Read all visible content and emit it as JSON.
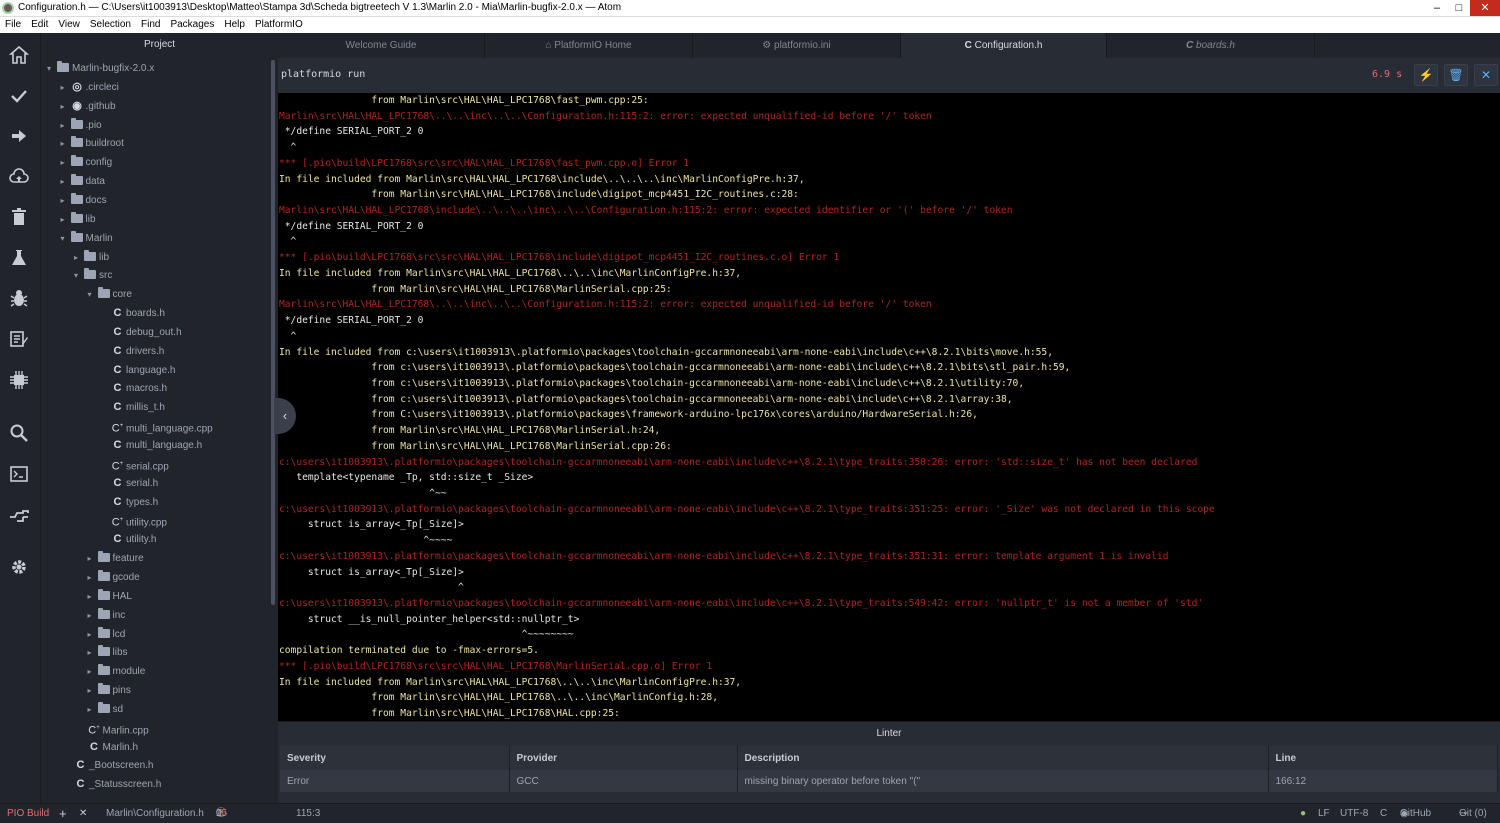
{
  "window": {
    "title": "Configuration.h — C:\\Users\\it1003913\\Desktop\\Matteo\\Stampa 3d\\Scheda bigtreetech V 1.3\\Marlin 2.0 - Mia\\Marlin-bugfix-2.0.x — Atom",
    "minimize": "–",
    "maximize": "□",
    "close": "✕"
  },
  "menu": [
    "File",
    "Edit",
    "View",
    "Selection",
    "Find",
    "Packages",
    "Help",
    "PlatformIO"
  ],
  "activity": [
    "home-icon",
    "check-icon",
    "arrow-right-icon",
    "cloud-upload-icon",
    "trash-icon",
    "flask-icon",
    "bug-icon",
    "edit-list-icon",
    "chip-icon",
    "search-icon",
    "terminal-icon",
    "plug-icon",
    "gear-icon"
  ],
  "tree": {
    "header": "Project",
    "items": [
      {
        "label": "Marlin-bugfix-2.0.x",
        "depth": 0,
        "kind": "folder",
        "open": true
      },
      {
        "label": ".circleci",
        "depth": 1,
        "kind": "circle",
        "open": false
      },
      {
        "label": ".github",
        "depth": 1,
        "kind": "github",
        "open": false
      },
      {
        "label": ".pio",
        "depth": 1,
        "kind": "folder",
        "open": false
      },
      {
        "label": "buildroot",
        "depth": 1,
        "kind": "folder",
        "open": false
      },
      {
        "label": "config",
        "depth": 1,
        "kind": "folder",
        "open": false
      },
      {
        "label": "data",
        "depth": 1,
        "kind": "folder",
        "open": false
      },
      {
        "label": "docs",
        "depth": 1,
        "kind": "folder",
        "open": false
      },
      {
        "label": "lib",
        "depth": 1,
        "kind": "folder",
        "open": false
      },
      {
        "label": "Marlin",
        "depth": 1,
        "kind": "folder",
        "open": true
      },
      {
        "label": "lib",
        "depth": 2,
        "kind": "folder",
        "open": false
      },
      {
        "label": "src",
        "depth": 2,
        "kind": "folder",
        "open": true
      },
      {
        "label": "core",
        "depth": 3,
        "kind": "folder",
        "open": true
      },
      {
        "label": "boards.h",
        "depth": 4,
        "kind": "c"
      },
      {
        "label": "debug_out.h",
        "depth": 4,
        "kind": "c"
      },
      {
        "label": "drivers.h",
        "depth": 4,
        "kind": "c"
      },
      {
        "label": "language.h",
        "depth": 4,
        "kind": "c"
      },
      {
        "label": "macros.h",
        "depth": 4,
        "kind": "c"
      },
      {
        "label": "millis_t.h",
        "depth": 4,
        "kind": "c"
      },
      {
        "label": "multi_language.cpp",
        "depth": 4,
        "kind": "cpp"
      },
      {
        "label": "multi_language.h",
        "depth": 4,
        "kind": "c"
      },
      {
        "label": "serial.cpp",
        "depth": 4,
        "kind": "cpp"
      },
      {
        "label": "serial.h",
        "depth": 4,
        "kind": "c"
      },
      {
        "label": "types.h",
        "depth": 4,
        "kind": "c"
      },
      {
        "label": "utility.cpp",
        "depth": 4,
        "kind": "cpp"
      },
      {
        "label": "utility.h",
        "depth": 4,
        "kind": "c"
      },
      {
        "label": "feature",
        "depth": 3,
        "kind": "folder",
        "open": false
      },
      {
        "label": "gcode",
        "depth": 3,
        "kind": "folder",
        "open": false
      },
      {
        "label": "HAL",
        "depth": 3,
        "kind": "folder",
        "open": false
      },
      {
        "label": "inc",
        "depth": 3,
        "kind": "folder",
        "open": false
      },
      {
        "label": "lcd",
        "depth": 3,
        "kind": "folder",
        "open": false
      },
      {
        "label": "libs",
        "depth": 3,
        "kind": "folder",
        "open": false
      },
      {
        "label": "module",
        "depth": 3,
        "kind": "folder",
        "open": false
      },
      {
        "label": "pins",
        "depth": 3,
        "kind": "folder",
        "open": false
      },
      {
        "label": "sd",
        "depth": 3,
        "kind": "folder",
        "open": false
      },
      {
        "label": "Marlin.cpp",
        "depth": 3,
        "kind": "cpp",
        "nochev": true
      },
      {
        "label": "Marlin.h",
        "depth": 3,
        "kind": "c",
        "nochev": true
      },
      {
        "label": "_Bootscreen.h",
        "depth": 2,
        "kind": "c",
        "nochev": true
      },
      {
        "label": "_Statusscreen.h",
        "depth": 2,
        "kind": "c",
        "nochev": true
      }
    ]
  },
  "tabs": [
    {
      "label": "Welcome Guide",
      "icon": ""
    },
    {
      "label": "PlatformIO Home",
      "icon": "⌂"
    },
    {
      "label": "platformio.ini",
      "icon": "⚙"
    },
    {
      "label": "Configuration.h",
      "icon": "C",
      "active": true
    },
    {
      "label": "boards.h",
      "icon": "C",
      "italic": true
    }
  ],
  "build": {
    "command": "platformio run",
    "time": "6.9 s",
    "lines": [
      {
        "t": "                from Marlin\\src\\HAL\\HAL_LPC1768\\fast_pwm.cpp:25:",
        "c": "yellow"
      },
      {
        "t": "Marlin\\src\\HAL\\HAL_LPC1768\\..\\..\\inc\\..\\..\\Configuration.h:115:2: error: expected unqualified-id before '/' token",
        "c": "red"
      },
      {
        "t": " */define SERIAL_PORT_2 0",
        "c": "white"
      },
      {
        "t": "  ^",
        "c": "white"
      },
      {
        "t": "*** [.pio\\build\\LPC1768\\src\\src\\HAL\\HAL_LPC1768\\fast_pwm.cpp.o] Error 1",
        "c": "red"
      },
      {
        "t": "In file included from Marlin\\src\\HAL\\HAL_LPC1768\\include\\..\\..\\..\\inc\\MarlinConfigPre.h:37,",
        "c": "yellow"
      },
      {
        "t": "                from Marlin\\src\\HAL\\HAL_LPC1768\\include\\digipot_mcp4451_I2C_routines.c:28:",
        "c": "yellow"
      },
      {
        "t": "Marlin\\src\\HAL\\HAL_LPC1768\\include\\..\\..\\..\\inc\\..\\..\\Configuration.h:115:2: error: expected identifier or '(' before '/' token",
        "c": "red"
      },
      {
        "t": " */define SERIAL_PORT_2 0",
        "c": "white"
      },
      {
        "t": "  ^",
        "c": "white"
      },
      {
        "t": "*** [.pio\\build\\LPC1768\\src\\src\\HAL\\HAL_LPC1768\\include\\digipot_mcp4451_I2C_routines.c.o] Error 1",
        "c": "red"
      },
      {
        "t": "In file included from Marlin\\src\\HAL\\HAL_LPC1768\\..\\..\\inc\\MarlinConfigPre.h:37,",
        "c": "yellow"
      },
      {
        "t": "                from Marlin\\src\\HAL\\HAL_LPC1768\\MarlinSerial.cpp:25:",
        "c": "yellow"
      },
      {
        "t": "Marlin\\src\\HAL\\HAL_LPC1768\\..\\..\\inc\\..\\..\\Configuration.h:115:2: error: expected unqualified-id before '/' token",
        "c": "red"
      },
      {
        "t": " */define SERIAL_PORT_2 0",
        "c": "white"
      },
      {
        "t": "  ^",
        "c": "white"
      },
      {
        "t": "In file included from c:\\users\\it1003913\\.platformio\\packages\\toolchain-gccarmnoneeabi\\arm-none-eabi\\include\\c++\\8.2.1\\bits\\move.h:55,",
        "c": "yellow"
      },
      {
        "t": "                from c:\\users\\it1003913\\.platformio\\packages\\toolchain-gccarmnoneeabi\\arm-none-eabi\\include\\c++\\8.2.1\\bits\\stl_pair.h:59,",
        "c": "yellow"
      },
      {
        "t": "                from c:\\users\\it1003913\\.platformio\\packages\\toolchain-gccarmnoneeabi\\arm-none-eabi\\include\\c++\\8.2.1\\utility:70,",
        "c": "yellow"
      },
      {
        "t": "                from c:\\users\\it1003913\\.platformio\\packages\\toolchain-gccarmnoneeabi\\arm-none-eabi\\include\\c++\\8.2.1\\array:38,",
        "c": "yellow"
      },
      {
        "t": "                from C:\\users\\it1003913\\.platformio\\packages\\framework-arduino-lpc176x\\cores\\arduino/HardwareSerial.h:26,",
        "c": "yellow"
      },
      {
        "t": "                from Marlin\\src\\HAL\\HAL_LPC1768\\MarlinSerial.h:24,",
        "c": "yellow"
      },
      {
        "t": "                from Marlin\\src\\HAL\\HAL_LPC1768\\MarlinSerial.cpp:26:",
        "c": "yellow"
      },
      {
        "t": "c:\\users\\it1003913\\.platformio\\packages\\toolchain-gccarmnoneeabi\\arm-none-eabi\\include\\c++\\8.2.1\\type_traits:350:26: error: 'std::size_t' has not been declared",
        "c": "red"
      },
      {
        "t": "   template<typename _Tp, std::size_t _Size>",
        "c": "white"
      },
      {
        "t": "                          ^~~",
        "c": "white"
      },
      {
        "t": "c:\\users\\it1003913\\.platformio\\packages\\toolchain-gccarmnoneeabi\\arm-none-eabi\\include\\c++\\8.2.1\\type_traits:351:25: error: '_Size' was not declared in this scope",
        "c": "red"
      },
      {
        "t": "     struct is_array<_Tp[_Size]>",
        "c": "white"
      },
      {
        "t": "                         ^~~~~",
        "c": "white"
      },
      {
        "t": "c:\\users\\it1003913\\.platformio\\packages\\toolchain-gccarmnoneeabi\\arm-none-eabi\\include\\c++\\8.2.1\\type_traits:351:31: error: template argument 1 is invalid",
        "c": "red"
      },
      {
        "t": "     struct is_array<_Tp[_Size]>",
        "c": "white"
      },
      {
        "t": "                               ^",
        "c": "white"
      },
      {
        "t": "c:\\users\\it1003913\\.platformio\\packages\\toolchain-gccarmnoneeabi\\arm-none-eabi\\include\\c++\\8.2.1\\type_traits:549:42: error: 'nullptr_t' is not a member of 'std'",
        "c": "red"
      },
      {
        "t": "     struct __is_null_pointer_helper<std::nullptr_t>",
        "c": "white"
      },
      {
        "t": "                                          ^~~~~~~~~",
        "c": "white"
      },
      {
        "t": "compilation terminated due to -fmax-errors=5.",
        "c": "yellow"
      },
      {
        "t": "*** [.pio\\build\\LPC1768\\src\\src\\HAL\\HAL_LPC1768\\MarlinSerial.cpp.o] Error 1",
        "c": "red"
      },
      {
        "t": "In file included from Marlin\\src\\HAL\\HAL_LPC1768\\..\\..\\inc\\MarlinConfigPre.h:37,",
        "c": "yellow"
      },
      {
        "t": "                from Marlin\\src\\HAL\\HAL_LPC1768\\..\\..\\inc\\MarlinConfig.h:28,",
        "c": "yellow"
      },
      {
        "t": "                from Marlin\\src\\HAL\\HAL_LPC1768\\HAL.cpp:25:",
        "c": "yellow"
      }
    ]
  },
  "linter": {
    "title": "Linter",
    "columns": [
      "Severity",
      "Provider",
      "Description",
      "Line"
    ],
    "rows": [
      [
        "Error",
        "GCC",
        "missing binary operator before token \"(\"",
        "166:12"
      ]
    ]
  },
  "status": {
    "build": "PIO Build",
    "plus": "+",
    "x": "✕",
    "file": "Marlin\\Configuration.h",
    "errors": "15",
    "warnings": "1",
    "infos": "0",
    "position": "115:3",
    "line_ending": "LF",
    "encoding": "UTF-8",
    "grammar": "C",
    "github": "GitHub",
    "git": "Git (0)"
  },
  "colors": {
    "accent": "#61afef",
    "error": "#e06c75",
    "status_build": "#e06c75"
  }
}
